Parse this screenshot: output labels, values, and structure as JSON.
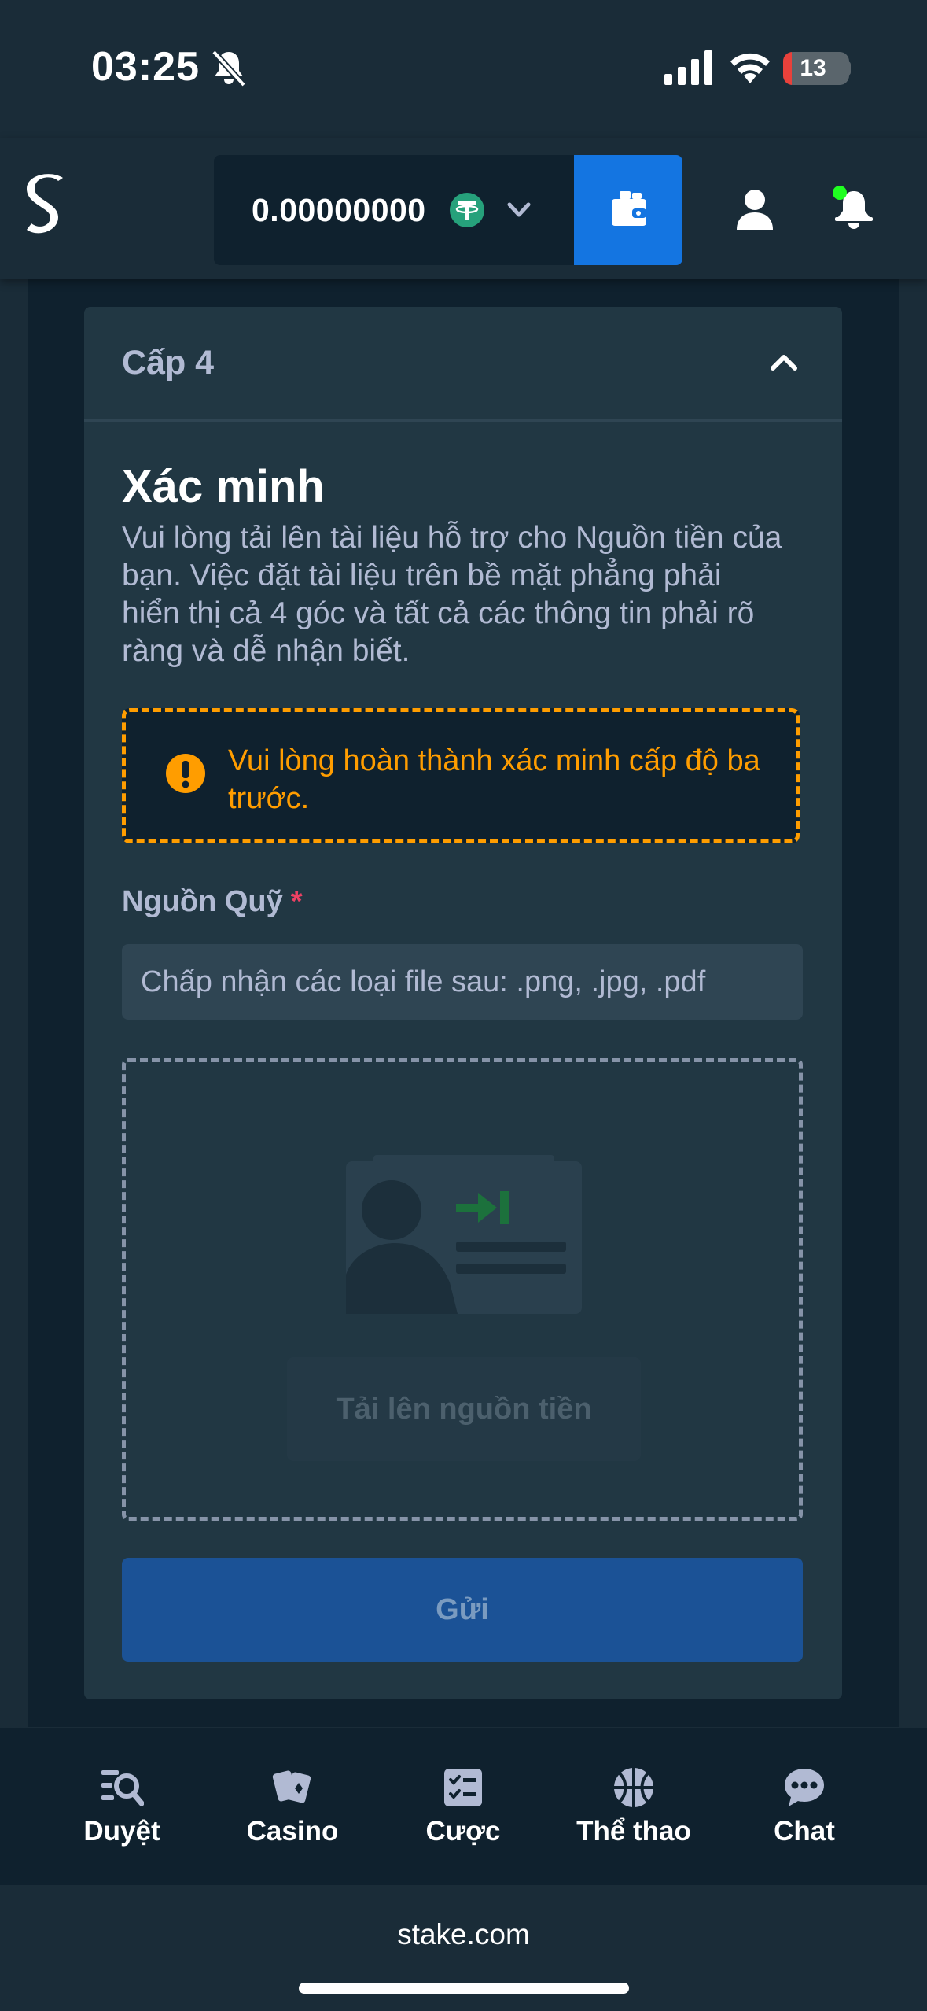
{
  "status_bar": {
    "time": "03:25",
    "battery_level": "13",
    "battery_fraction": 0.13,
    "battery_low_color": "#e9413b"
  },
  "header": {
    "balance": "0.00000000",
    "currency_icon": "tether-icon",
    "accent_color": "#1475e1"
  },
  "card": {
    "level_title": "Cấp 4",
    "section_title": "Xác minh",
    "description": "Vui lòng tải lên tài liệu hỗ trợ cho Nguồn tiền của bạn. Việc đặt tài liệu trên bề mặt phẳng phải hiển thị cả 4 góc và tất cả các thông tin phải rõ ràng và dễ nhận biết.",
    "warning_text": "Vui lòng hoàn thành xác minh cấp độ ba trước.",
    "warning_color": "#ff9d00",
    "field_label": "Nguồn Quỹ",
    "required_mark": "*",
    "file_hint": "Chấp nhận các loại file sau: .png, .jpg, .pdf",
    "upload_button": "Tải lên nguồn tiền",
    "submit_button": "Gửi"
  },
  "bottom_nav": {
    "items": [
      {
        "label": "Duyệt",
        "icon": "browse-icon"
      },
      {
        "label": "Casino",
        "icon": "cards-icon"
      },
      {
        "label": "Cược",
        "icon": "betslip-icon"
      },
      {
        "label": "Thể thao",
        "icon": "basketball-icon"
      },
      {
        "label": "Chat",
        "icon": "chat-icon"
      }
    ]
  },
  "browser": {
    "url": "stake.com"
  }
}
